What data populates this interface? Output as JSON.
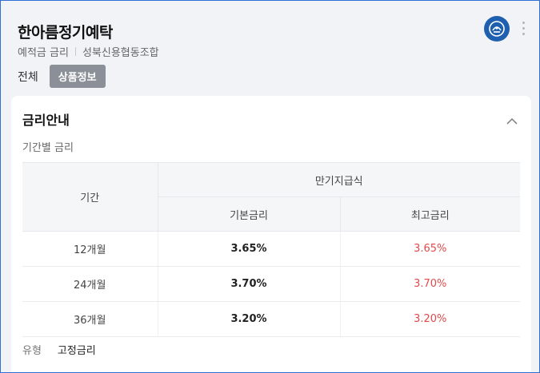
{
  "product": {
    "title": "한아름정기예탁",
    "subtitle_left": "예적금 금리",
    "subtitle_right": "성북신용협동조합"
  },
  "tabs": [
    "전체",
    "상품정보"
  ],
  "active_tab": "상품정보",
  "card": {
    "title": "금리안내",
    "section_label": "기간별 금리",
    "table": {
      "period_header": "기간",
      "group_header": "만기지급식",
      "col_base": "기본금리",
      "col_max": "최고금리",
      "rows": [
        {
          "period": "12개월",
          "base": "3.65%",
          "max": "3.65%"
        },
        {
          "period": "24개월",
          "base": "3.70%",
          "max": "3.70%"
        },
        {
          "period": "36개월",
          "base": "3.20%",
          "max": "3.20%"
        }
      ]
    },
    "type_label": "유형",
    "type_value": "고정금리"
  },
  "colors": {
    "accent_red": "#e04a4a",
    "logo_blue": "#1f5fb0",
    "active_tab_bg": "#8a8f98"
  }
}
